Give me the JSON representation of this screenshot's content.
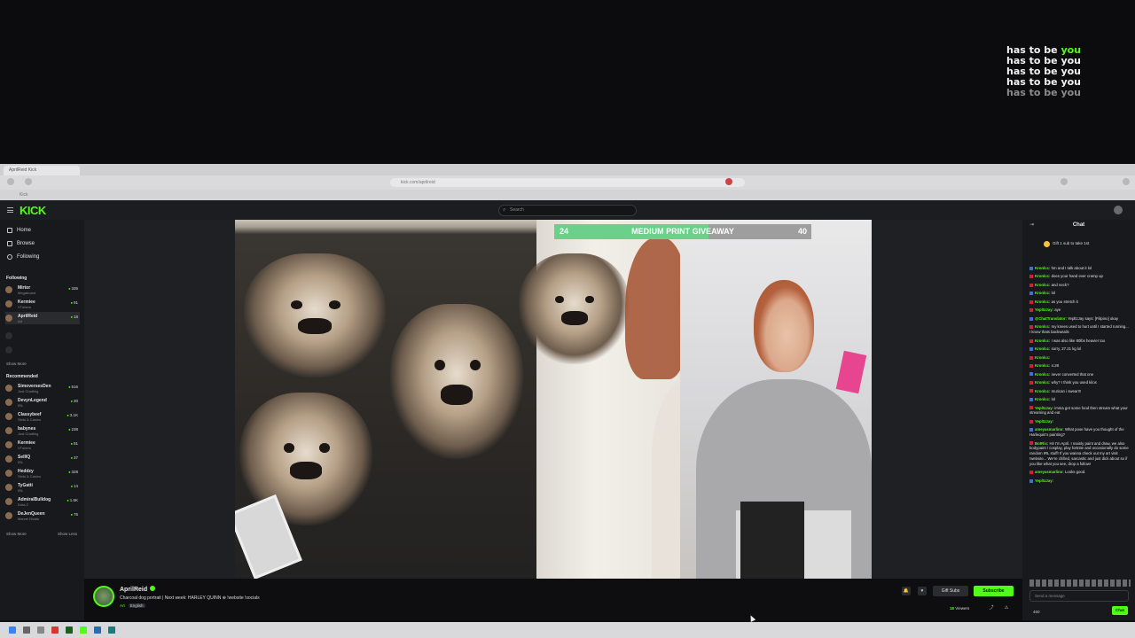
{
  "overlay": {
    "lyrics": [
      "has to be",
      "you",
      "has to be you",
      "has to be you",
      "has to be you",
      "has to be you"
    ]
  },
  "browser": {
    "tab_title": "AprilReid Kick",
    "url": "kick.com/aprilreid",
    "bookmark": "Kick"
  },
  "header": {
    "logo": "KICK",
    "search_placeholder": "Search"
  },
  "sidebar": {
    "nav": [
      "Home",
      "Browse",
      "Following"
    ],
    "following_title": "Following",
    "following": [
      {
        "name": "Mirtor",
        "category": "Megaboard",
        "viewers": "335"
      },
      {
        "name": "Kermiee",
        "category": "VTubers",
        "viewers": "91"
      },
      {
        "name": "AprilReid",
        "category": "Art",
        "viewers": "18"
      }
    ],
    "show_more": "Show More",
    "recommended_title": "Recommended",
    "recommended": [
      {
        "name": "SimoversesDen",
        "category": "Just Chatting",
        "viewers": "516"
      },
      {
        "name": "DevynLegend",
        "category": "IRL",
        "viewers": "30"
      },
      {
        "name": "Classybeef",
        "category": "Slots & Casino",
        "viewers": "3.1K"
      },
      {
        "name": "babynes",
        "category": "Just Chatting",
        "viewers": "238"
      },
      {
        "name": "Kermiee",
        "category": "VTubers",
        "viewers": "91"
      },
      {
        "name": "SellIQ",
        "category": "IRL",
        "viewers": "37"
      },
      {
        "name": "Heddzy",
        "category": "Slots & Casino",
        "viewers": "328"
      },
      {
        "name": "TyGatti",
        "category": "IRL",
        "viewers": "14"
      },
      {
        "name": "AdmiralBulldog",
        "category": "Dota 2",
        "viewers": "1.6K"
      },
      {
        "name": "DeJenQueen",
        "category": "Marvel Rivals",
        "viewers": "76"
      }
    ],
    "show_more2": "Show More",
    "show_less": "Show Less"
  },
  "giveaway": {
    "left": "24",
    "title": "MEDIUM PRINT GIVEAWAY",
    "right": "40",
    "progress": 0.6
  },
  "chat": {
    "title": "Chat",
    "pinned": "Gift 1 sub to take 1st",
    "messages": [
      {
        "user": "Kronlcc:",
        "text": "hm and I talk about it lol"
      },
      {
        "user": "Kronlcc:",
        "text": "does your hand ever cramp up"
      },
      {
        "user": "Kronlcc:",
        "text": "and neck?"
      },
      {
        "user": "Kronlcc:",
        "text": "lol"
      },
      {
        "user": "Kronlcc:",
        "text": "as you stretch it"
      },
      {
        "user": "YepltzJay:",
        "text": "aye"
      },
      {
        "user": "@ChatTranslator:",
        "text": "YepltzJay says: [Filipino] okay"
      },
      {
        "user": "Kronlcc:",
        "text": "my knees used to hurt until I started running... I know thats backwards"
      },
      {
        "user": "Kronlcc:",
        "text": "I was also like 80lbs heavier too"
      },
      {
        "user": "Kronlcc:",
        "text": "sorry, 27.21 kg lol"
      },
      {
        "user": "Kronlcc:",
        "text": ""
      },
      {
        "user": "Kronlcc:",
        "text": "4.28"
      },
      {
        "user": "Kronlcc:",
        "text": "never converted that one"
      },
      {
        "user": "Kronlcc:",
        "text": "why? I think you used kilos"
      },
      {
        "user": "Kronlcc:",
        "text": "murican i swear!!!"
      },
      {
        "user": "Kronlcc:",
        "text": "lol"
      },
      {
        "user": "YepltzJay:",
        "text": "imma get some food then stream what your streaming and eat"
      },
      {
        "user": "YepltzJay:",
        "text": ""
      },
      {
        "user": "ameyasmarlino:",
        "text": "What pose have you thought of the Harlequin's painting?"
      },
      {
        "user": "BotRix:",
        "text": "Hi! I'm April. I mainly paint and draw, we also bodypaint / cosplay, play fortnite and occasionally do some random IRL stuff! If you wanna check out my art visit !website... We're chilled, sarcastic and just dick about so if you like what you see, drop a follow!"
      },
      {
        "user": "ameyasmarlino:",
        "text": "Looks good."
      },
      {
        "user": "YepltzJay:",
        "text": ""
      }
    ],
    "input_placeholder": "Send a message",
    "points": "460",
    "send": "Chat"
  },
  "stream": {
    "streamer": "AprilReid",
    "title": "Charcoal dog portrait | Next week: HARLEY QUINN ⊕ !website !socials",
    "category": "Art",
    "tag": "English",
    "gift_label": "Gift Subs",
    "subscribe_label": "Subscribe",
    "viewers": "18",
    "viewers_label": "Viewers"
  },
  "colors": {
    "accent": "#53fc18",
    "background": "#0e0e10",
    "panel": "#18191c"
  }
}
